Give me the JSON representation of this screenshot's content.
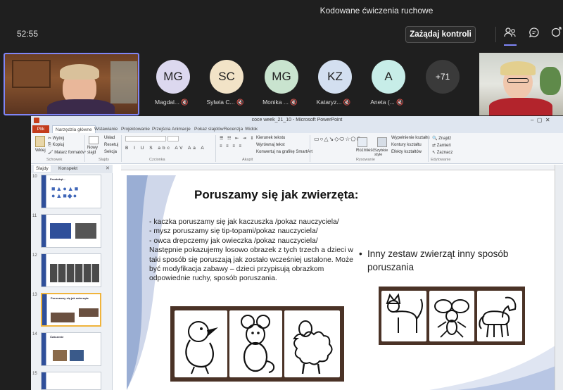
{
  "meeting": {
    "title": "Kodowane ćwiczenia ruchowe",
    "timer": "52:55",
    "request_control": "Zażądaj kontroli"
  },
  "icons": {
    "people": "people-icon",
    "chat": "chat-icon",
    "share": "share-screen-icon"
  },
  "participants": [
    {
      "initials": "MG",
      "name": "Magdal...",
      "color": "#dcd8ef"
    },
    {
      "initials": "SC",
      "name": "Sylwia C...",
      "color": "#f2e3c7"
    },
    {
      "initials": "MG",
      "name": "Monika ...",
      "color": "#c9e4cf"
    },
    {
      "initials": "KZ",
      "name": "Kataryz...",
      "color": "#d3dff0"
    },
    {
      "initials": "A",
      "name": "Aneta (...",
      "color": "#c7ede8"
    }
  ],
  "overflow_count": "+71",
  "ppt": {
    "window_title": "coce week_21_10 - Microsoft PowerPoint",
    "tabs": [
      "Plik",
      "Narzędzia główne",
      "Wstawianie",
      "Projektowanie",
      "Przejścia",
      "Animacje",
      "Pokaz slajdów",
      "Recenzja",
      "Widok"
    ],
    "ribbon": {
      "clipboard": [
        "Wytnij",
        "Kopiuj",
        "Malarz formatów"
      ],
      "paste": "Wklej",
      "new_slide": "Nowy slajd",
      "slide_buttons": [
        "Układ",
        "Resetuj",
        "Sekcja"
      ],
      "paragraph_buttons": [
        "Kierunek tekstu",
        "Wyrównaj tekst",
        "Konwertuj na grafikę SmartArt"
      ],
      "arrange": "Rozmieść",
      "quick_styles": "Szybkie style",
      "shape_buttons": [
        "Wypełnienie kształtu",
        "Kontury kształtu",
        "Efekty kształtów"
      ],
      "edit_buttons": [
        "Znajdź",
        "Zamień",
        "Zaznacz"
      ],
      "groups": [
        "Schowek",
        "Slajdy",
        "Czcionka",
        "Akapit",
        "Rysowanie",
        "Edytowanie"
      ]
    },
    "pane_tabs": [
      "Slajdy",
      "Konspekt"
    ],
    "thumbnails": [
      {
        "num": "10",
        "title": "Prostokąt..."
      },
      {
        "num": "11",
        "title": ""
      },
      {
        "num": "12",
        "title": ""
      },
      {
        "num": "13",
        "title": "Poruszamy się jak zwierzęta"
      },
      {
        "num": "14",
        "title": "Ćwiczenie"
      },
      {
        "num": "15",
        "title": ""
      }
    ],
    "slide": {
      "title": "Poruszamy się jak zwierzęta:",
      "lines": [
        "- kaczka poruszamy się jak kaczuszka /pokaz nauczyciela/",
        "- mysz poruszamy się tip-topami/pokaz nauczyciela/",
        "- owca drepczemy jak owieczka /pokaz nauczyciela/",
        "Następnie pokazujemy losowo obrazek z tych trzech a dzieci w taki sposób się poruszają jak zostało wcześniej ustalone. Może być modyfikacja zabawy – dzieci przypisują obrazkom odpowiednie ruchy, sposób poruszania."
      ],
      "bullet": "Inny zestaw zwierząt inny sposób poruszania"
    }
  }
}
